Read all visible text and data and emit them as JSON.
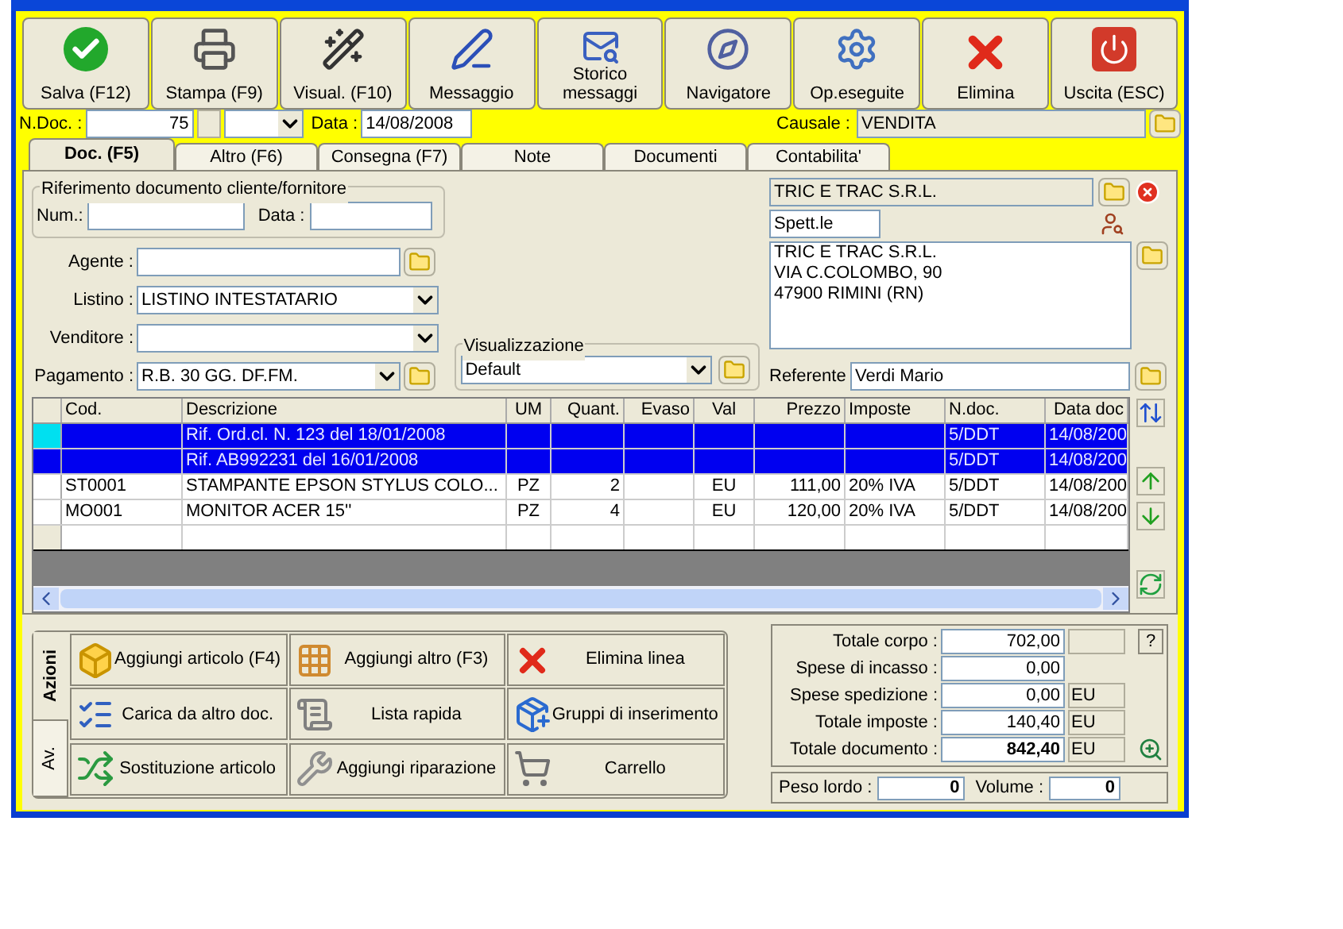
{
  "toolbar": [
    {
      "label": "Salva (F12)"
    },
    {
      "label": "Stampa (F9)"
    },
    {
      "label": "Visual. (F10)"
    },
    {
      "label": "Messaggio"
    },
    {
      "label": "Storico messaggi"
    },
    {
      "label": "Navigatore"
    },
    {
      "label": "Op.eseguite"
    },
    {
      "label": "Elimina"
    },
    {
      "label": "Uscita (ESC)"
    }
  ],
  "header": {
    "ndoc_label": "N.Doc. :",
    "ndoc_value": "75",
    "date_label": "Data :",
    "date_value": "14/08/2008",
    "causale_label": "Causale :",
    "causale_value": "VENDITA"
  },
  "tabs": [
    {
      "label": "Doc. (F5)",
      "selected": true
    },
    {
      "label": "Altro (F6)",
      "selected": false
    },
    {
      "label": "Consegna (F7)",
      "selected": false
    },
    {
      "label": "Note",
      "selected": false
    },
    {
      "label": "Documenti",
      "selected": false
    },
    {
      "label": "Contabilita'",
      "selected": false
    }
  ],
  "reference": {
    "title": "Riferimento documento cliente/fornitore",
    "num_label": "Num.:",
    "date_label": "Data :"
  },
  "fields": {
    "agent_label": "Agente :",
    "list_label": "Listino :",
    "list_value": "LISTINO INTESTATARIO",
    "seller_label": "Venditore :",
    "payment_label": "Pagamento :",
    "payment_value": "R.B. 30 GG. DF.FM."
  },
  "view": {
    "title": "Visualizzazione",
    "value": "Default"
  },
  "client": {
    "name": "TRIC E TRAC S.R.L.",
    "salutation": "Spett.le",
    "address": [
      "TRIC E TRAC S.R.L.",
      "VIA C.COLOMBO, 90",
      "47900 RIMINI (RN)"
    ],
    "contact_label": "Referente",
    "contact_value": "Verdi Mario"
  },
  "table": {
    "columns": [
      "Cod.",
      "Descrizione",
      "UM",
      "Quant.",
      "Evaso",
      "Val",
      "Prezzo",
      "Imposte",
      "N.doc.",
      "Data doc"
    ],
    "rows": [
      {
        "selected": true,
        "current": true,
        "cells": [
          null,
          "Rif. Ord.cl. N. 123 del 18/01/2008",
          null,
          null,
          null,
          null,
          null,
          null,
          "5/DDT",
          "14/08/200"
        ]
      },
      {
        "selected": true,
        "current": false,
        "cells": [
          null,
          "Rif. AB992231 del 16/01/2008",
          null,
          null,
          null,
          null,
          null,
          null,
          "5/DDT",
          "14/08/200"
        ]
      },
      {
        "selected": false,
        "current": false,
        "cells": [
          "ST0001",
          "STAMPANTE EPSON STYLUS COLO...",
          "PZ",
          "2",
          null,
          "EU",
          "111,00",
          "20% IVA",
          "5/DDT",
          "14/08/200"
        ]
      },
      {
        "selected": false,
        "current": false,
        "cells": [
          "MO001",
          "MONITOR ACER 15''",
          "PZ",
          "4",
          null,
          "EU",
          "120,00",
          "20% IVA",
          "5/DDT",
          "14/08/200"
        ]
      }
    ]
  },
  "actions": {
    "side_tabs": [
      {
        "label": "Azioni",
        "selected": true
      },
      {
        "label": "Av.",
        "selected": false
      }
    ],
    "buttons": [
      "Aggiungi articolo (F4)",
      "Aggiungi altro (F3)",
      "Elimina linea",
      "Carica da altro doc.",
      "Lista rapida",
      "Gruppi di inserimento",
      "Sostituzione articolo",
      "Aggiungi riparazione",
      "Carrello"
    ]
  },
  "totals": {
    "rows": [
      {
        "label": "Totale corpo :",
        "value": "702,00",
        "unit_field": true,
        "bold": false
      },
      {
        "label": "Spese di incasso :",
        "value": "0,00",
        "unit_field": false,
        "bold": false
      },
      {
        "label": "Spese spedizione :",
        "value": "0,00",
        "unit_field": true,
        "unit": "EU",
        "bold": false
      },
      {
        "label": "Totale imposte :",
        "value": "140,40",
        "unit_field": true,
        "unit": "EU",
        "bold": false
      },
      {
        "label": "Totale documento :",
        "value": "842,40",
        "unit_field": true,
        "unit": "EU",
        "bold": true
      }
    ],
    "help_button": "?",
    "weight_label": "Peso lordo :",
    "weight_value": "0",
    "volume_label": "Volume :",
    "volume_value": "0"
  }
}
